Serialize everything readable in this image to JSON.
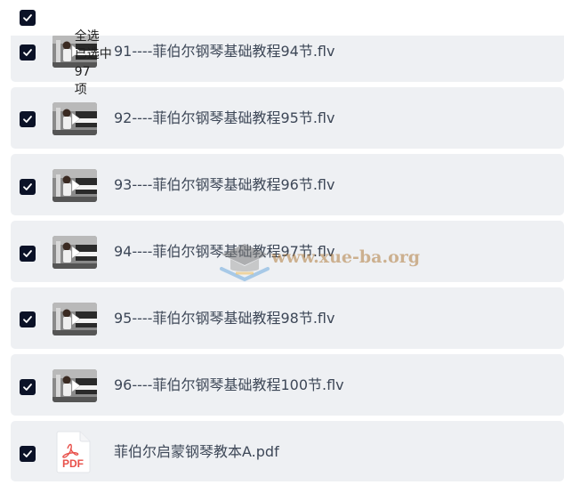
{
  "header": {
    "select_all_label": "全选",
    "selected_label": "已选中",
    "selected_count": "97",
    "unit_label": "项"
  },
  "files": [
    {
      "name": "91----菲伯尔钢琴基础教程94节.flv",
      "type": "video",
      "checked": true
    },
    {
      "name": "92----菲伯尔钢琴基础教程95节.flv",
      "type": "video",
      "checked": true
    },
    {
      "name": "93----菲伯尔钢琴基础教程96节.flv",
      "type": "video",
      "checked": true
    },
    {
      "name": "94----菲伯尔钢琴基础教程97节.flv",
      "type": "video",
      "checked": true
    },
    {
      "name": "95----菲伯尔钢琴基础教程98节.flv",
      "type": "video",
      "checked": true
    },
    {
      "name": "96----菲伯尔钢琴基础教程100节.flv",
      "type": "video",
      "checked": true
    },
    {
      "name": "菲伯尔启蒙钢琴教本A.pdf",
      "type": "pdf",
      "checked": true
    }
  ],
  "pdf_icon_label": "PDF",
  "watermark": {
    "text": "www.xue-ba.org"
  },
  "colors": {
    "checkbox": "#0b1227",
    "row_background": "#eef0f3",
    "file_name_text": "#3d4757",
    "pdf_red": "#e8504a",
    "watermark": "#b07c3c"
  }
}
